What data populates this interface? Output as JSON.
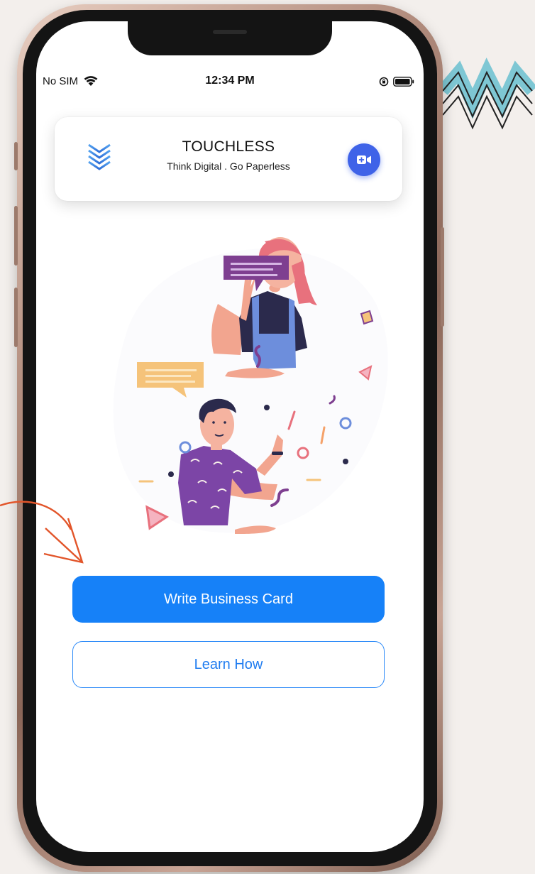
{
  "status_bar": {
    "carrier": "No SIM",
    "time": "12:34 PM"
  },
  "header": {
    "title": "TOUCHLESS",
    "tagline": "Think Digital . Go Paperless",
    "logo_icon": "layered-chevrons-icon",
    "video_button_icon": "video-camera-icon"
  },
  "actions": {
    "write_label": "Write Business Card",
    "learn_label": "Learn How"
  },
  "colors": {
    "primary": "#1681f8",
    "video_button": "#3f63e8",
    "frame": "#b48f80",
    "backdrop": "#f3efec"
  }
}
